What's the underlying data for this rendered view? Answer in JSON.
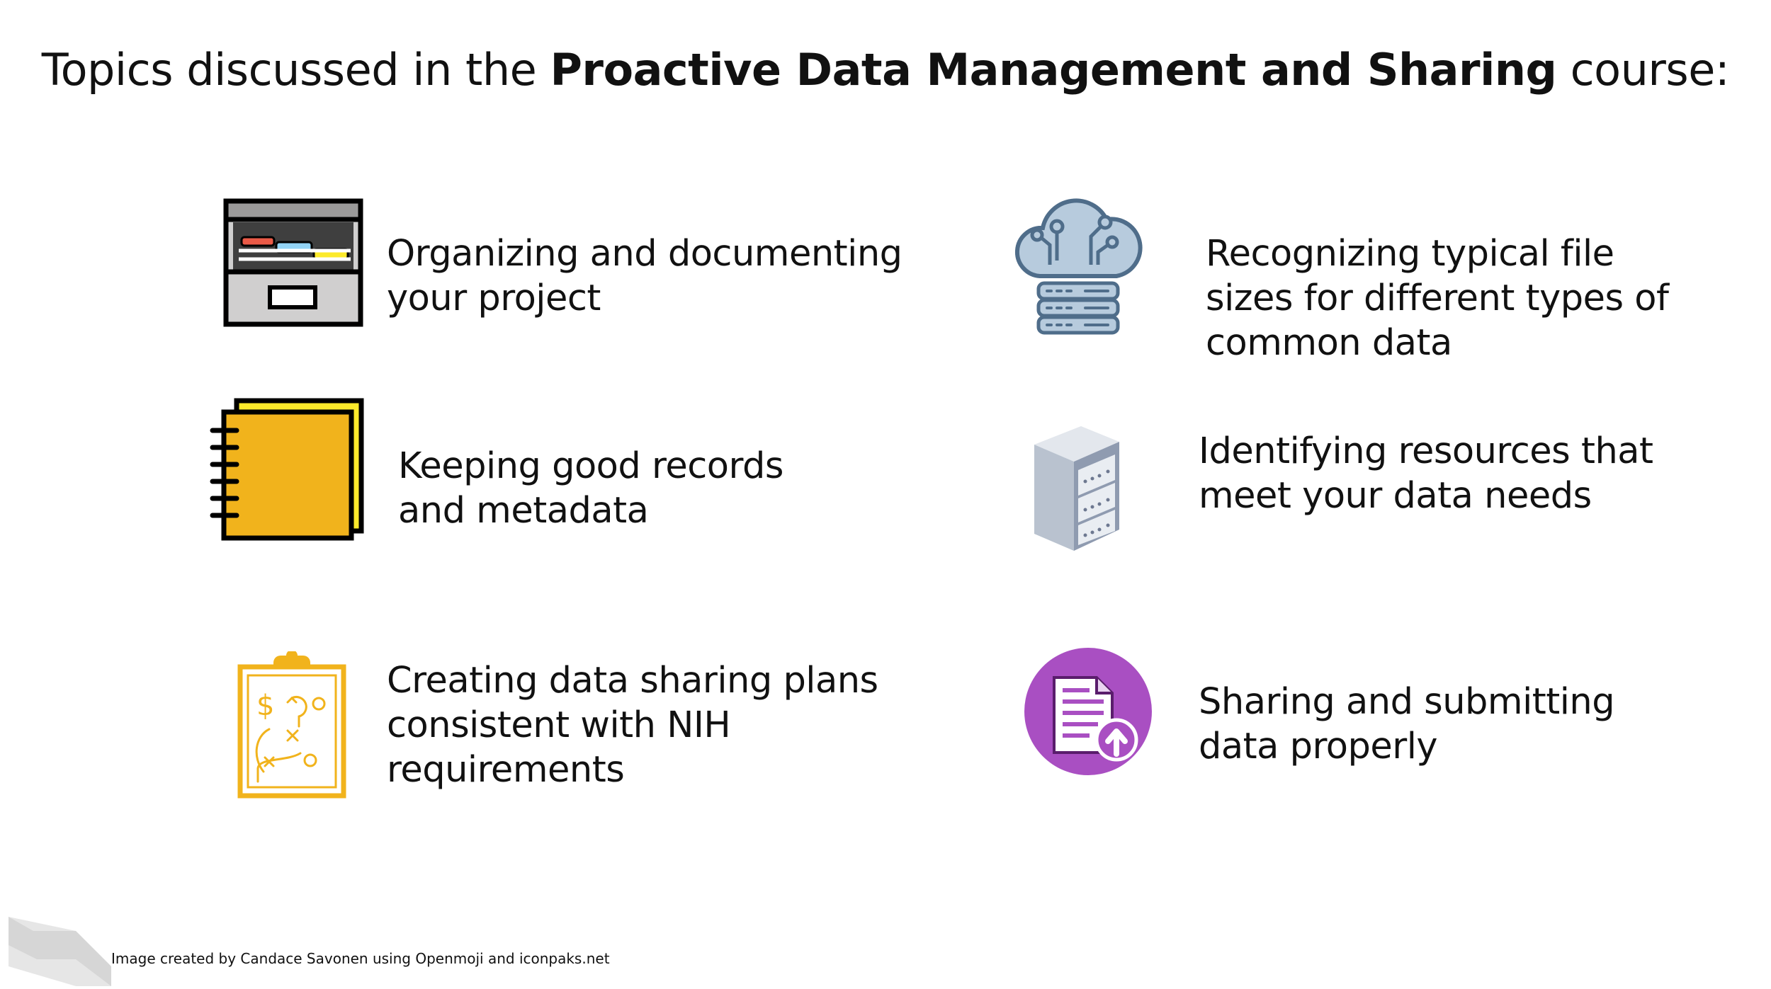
{
  "title": {
    "prefix": "Topics discussed in the ",
    "emphasis": "Proactive Data Management and Sharing",
    "suffix": " course:"
  },
  "topics": [
    {
      "text": "Organizing and documenting\nyour project",
      "icon": "file-cabinet-icon"
    },
    {
      "text": "Keeping good records\nand metadata",
      "icon": "notebook-icon"
    },
    {
      "text": "Creating data sharing plans\nconsistent with NIH\nrequirements",
      "icon": "clipboard-plan-icon"
    },
    {
      "text": "Recognizing typical file\nsizes for different types of\ncommon data",
      "icon": "cloud-server-icon"
    },
    {
      "text": "Identifying resources that\nmeet your data needs",
      "icon": "server-rack-icon"
    },
    {
      "text": "Sharing and submitting\ndata properly",
      "icon": "document-upload-icon"
    }
  ],
  "credit": "Image created by Candace Savonen using Openmoji and iconpaks.net",
  "colors": {
    "notebook": "#F1B31C",
    "notebook_back": "#FCEA2B",
    "clipboard": "#F1B31C",
    "cloud": "#B7CBDD",
    "server_blue": "#4F6D8A",
    "upload_circle": "#A94FC2"
  }
}
